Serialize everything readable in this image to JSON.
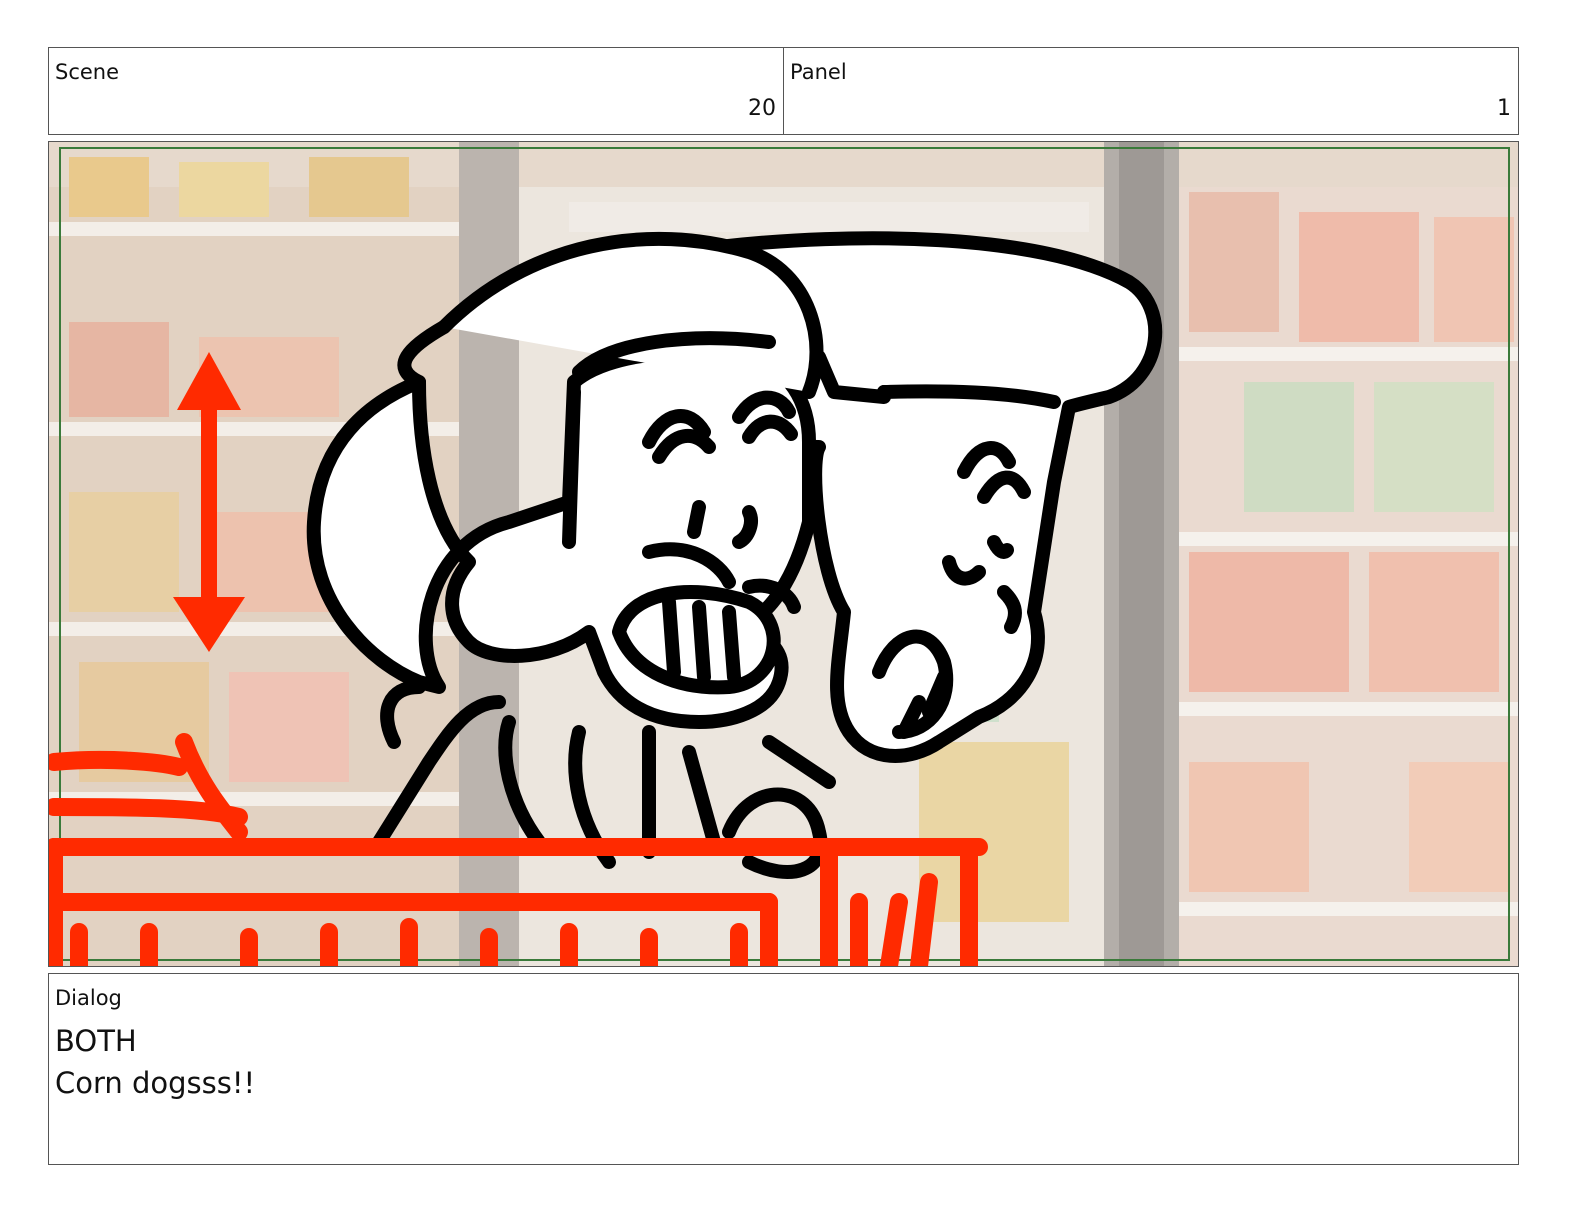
{
  "header": {
    "scene_label": "Scene",
    "scene_value": "20",
    "panel_label": "Panel",
    "panel_value": "1"
  },
  "panel": {
    "image_subject": "store-aisle-sketch",
    "colors": {
      "guide": "#3a7a3a",
      "red": "#ff2a00",
      "ink": "#000000"
    }
  },
  "dialog": {
    "label": "Dialog",
    "character": "BOTH",
    "line": "Corn dogsss!!"
  }
}
